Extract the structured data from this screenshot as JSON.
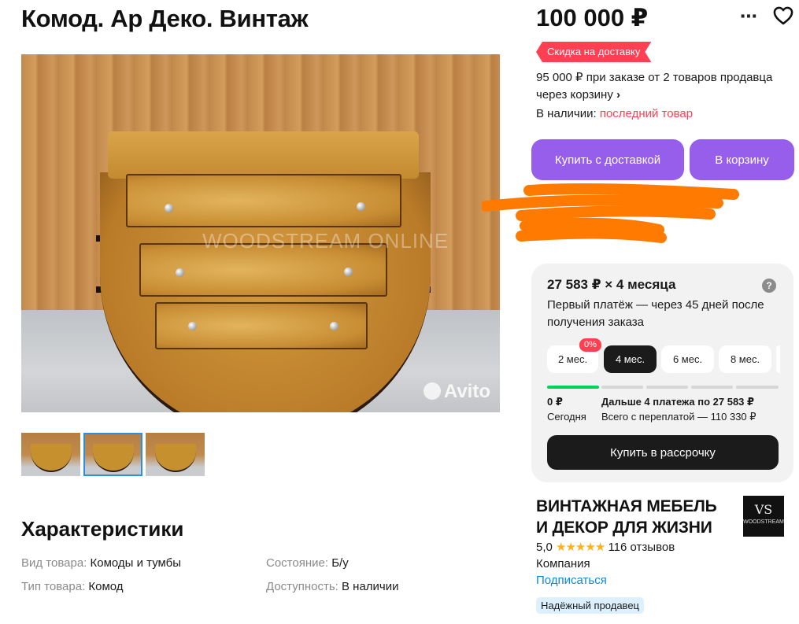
{
  "listing": {
    "title": "Комод. Ар Деко. Винтаж",
    "photo_watermark": "WOODSTREAM ONLINE",
    "photo_brand": "Avito",
    "thumbnail_count": 3,
    "active_thumbnail": 2
  },
  "specs": {
    "title": "Характеристики",
    "items": [
      {
        "key": "Вид товара:",
        "value": "Комоды и тумбы"
      },
      {
        "key": "Состояние:",
        "value": "Б/у"
      },
      {
        "key": "Тип товара:",
        "value": "Комод"
      },
      {
        "key": "Доступность:",
        "value": "В наличии"
      }
    ]
  },
  "pricing": {
    "price": "100 000 ₽",
    "discount_badge": "Скидка на доставку",
    "discount_text": "95 000 ₽ при заказе от 2 товаров продавца через корзину",
    "discount_chevron": "›",
    "stock_label": "В наличии:",
    "stock_value": "последний товар",
    "more_icon": "⋯",
    "heart_icon": "heart-outline"
  },
  "buttons": {
    "buy_delivery": "Купить с доставкой",
    "add_to_cart": "В корзину"
  },
  "installment": {
    "headline": "27 583 ₽ × 4 месяца",
    "help_icon": "?",
    "subtitle": "Первый платёж — через 45 дней после получения заказа",
    "zero_badge": "0%",
    "options": [
      "2 мес.",
      "4 мес.",
      "6 мес.",
      "8 мес."
    ],
    "selected_option": 1,
    "today_amount": "0 ₽",
    "today_label": "Сегодня",
    "next_payments": "Дальше 4 платежа по 27 583 ₽",
    "total_overpay": "Всего с переплатой — 110 330 ₽",
    "buy_button": "Купить в рассрочку",
    "progress_paid_segments": 1,
    "progress_total_segments": 4
  },
  "seller": {
    "name": "ВИНТАЖНАЯ МЕБЕЛЬ И ДЕКОР ДЛЯ ЖИЗНИ",
    "logo_mark": "VS",
    "logo_text": "WOODSTREAM",
    "rating": "5,0",
    "stars": "★★★★★",
    "reviews": "116 отзывов",
    "type": "Компания",
    "subscribe": "Подписаться",
    "trusted_badge": "Надёжный продавец"
  },
  "colors": {
    "accent_violet": "#965eeb",
    "discount_red": "#ff4053",
    "progress_green": "#02d15c",
    "link_blue": "#0a8ad8",
    "redaction_orange": "#ff7a00"
  }
}
